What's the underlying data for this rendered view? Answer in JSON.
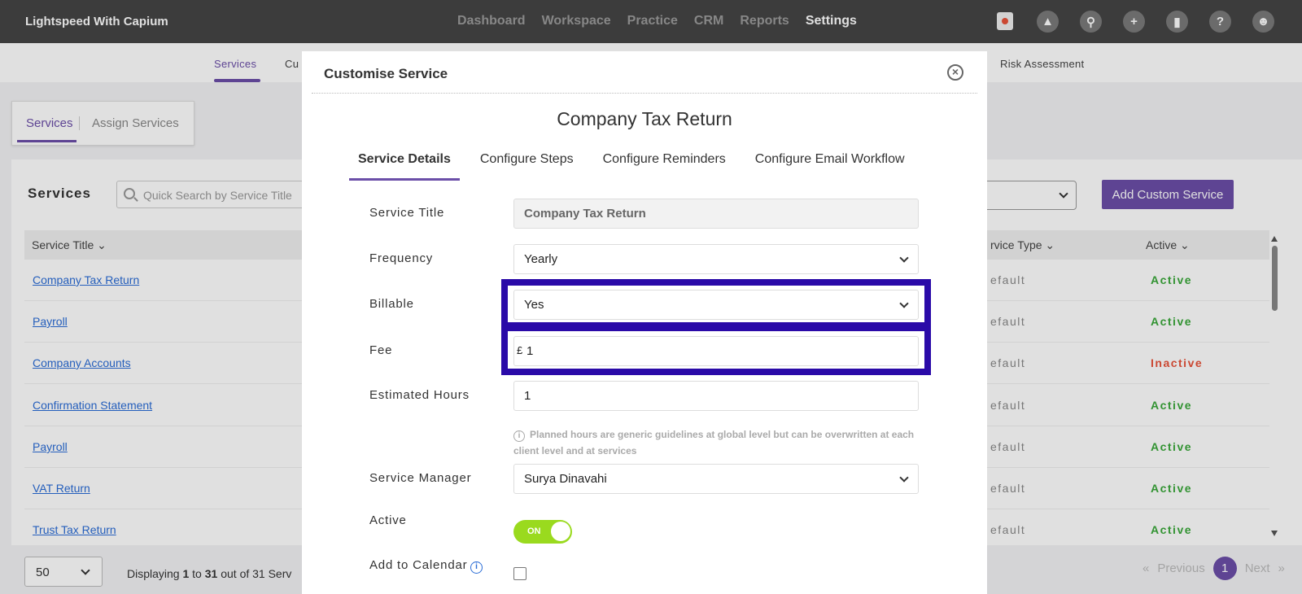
{
  "app": {
    "brand": "Lightspeed With Capium"
  },
  "nav": {
    "items": [
      "Dashboard",
      "Workspace",
      "Practice",
      "CRM",
      "Reports",
      "Settings"
    ],
    "active": "Settings"
  },
  "header_icons": [
    "calendar-icon",
    "megaphone-icon",
    "search-icon",
    "plus-icon",
    "ticket-icon",
    "help-icon",
    "user-icon"
  ],
  "subnav": {
    "services": "Services",
    "cu": "Cu",
    "risk": "Risk Assessment"
  },
  "page_tabs": {
    "services": "Services",
    "assign": "Assign Services"
  },
  "services_panel": {
    "title": "Services",
    "search_placeholder": "Quick Search by Service Title",
    "add_button": "Add Custom Service",
    "columns": {
      "title": "Service Title",
      "type": "rvice Type",
      "active": "Active"
    },
    "rows": [
      {
        "title": "Company Tax Return",
        "type": "efault",
        "status": "Active"
      },
      {
        "title": "Payroll",
        "type": "efault",
        "status": "Active"
      },
      {
        "title": "Company Accounts",
        "type": "efault",
        "status": "Inactive"
      },
      {
        "title": "Confirmation Statement",
        "type": "efault",
        "status": "Active"
      },
      {
        "title": "Payroll",
        "type": "efault",
        "status": "Active"
      },
      {
        "title": "VAT Return",
        "type": "efault",
        "status": "Active"
      },
      {
        "title": "Trust Tax Return",
        "type": "efault",
        "status": "Active"
      }
    ]
  },
  "footer": {
    "page_size": "50",
    "displaying_prefix": "Displaying ",
    "from": "1",
    "to_word": " to ",
    "to": "31",
    "suffix": " out of 31 Serv",
    "prev": "Previous",
    "page": "1",
    "next": "Next",
    "first_arrows": "«",
    "last_arrows": "»"
  },
  "modal": {
    "title": "Customise Service",
    "service_name": "Company Tax Return",
    "tabs": [
      "Service Details",
      "Configure Steps",
      "Configure Reminders",
      "Configure Email Workflow"
    ],
    "labels": {
      "service_title": "Service Title",
      "frequency": "Frequency",
      "billable": "Billable",
      "fee": "Fee",
      "estimated_hours": "Estimated Hours",
      "service_manager": "Service Manager",
      "active": "Active",
      "add_to_calendar": "Add to Calendar"
    },
    "values": {
      "service_title": "Company Tax Return",
      "frequency": "Yearly",
      "billable": "Yes",
      "fee_currency": "£",
      "fee": "1",
      "estimated_hours": "1",
      "service_manager": "Surya Dinavahi",
      "active_toggle": "ON"
    },
    "hint": "Planned hours are generic guidelines at global level but can be overwritten at each client level and at services",
    "highlight_color": "#2a0aa8"
  }
}
